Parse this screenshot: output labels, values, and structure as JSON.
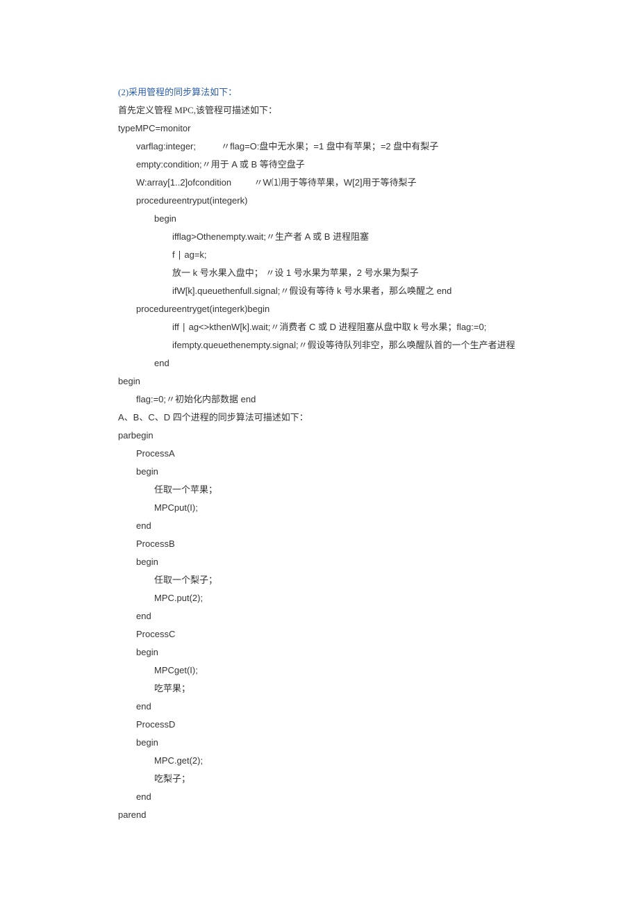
{
  "lines": [
    {
      "cls": "blue",
      "text": "(2)采用管程的同步算法如下："
    },
    {
      "cls": "",
      "text": "首先定义管程 MPC,该管程可描述如下："
    },
    {
      "cls": "mono",
      "text": "typeMPC=monitor"
    },
    {
      "cls": "mono i1",
      "text": "varflag:integer;          〃flag=O:盘中无水果；=1 盘中有苹果；=2 盘中有梨子"
    },
    {
      "cls": "mono i1",
      "text": "empty:condition;〃用于 A 或 B 等待空盘子"
    },
    {
      "cls": "mono i1",
      "text": "W:array[1..2]ofcondition         〃W⑴用于等待苹果，W[2]用于等待梨子"
    },
    {
      "cls": "mono i1",
      "text": "procedureentryput(integerk)"
    },
    {
      "cls": "mono i2",
      "text": "begin"
    },
    {
      "cls": "mono i3",
      "text": "ifflag>Othenempty.wait;〃生产者 A 或 B 进程阻塞"
    },
    {
      "cls": "mono i3",
      "text": "f ∣ ag=k;"
    },
    {
      "cls": "mono i3",
      "text": "放一 k 号水果入盘中； 〃设 1 号水果为苹果，2 号水果为梨子"
    },
    {
      "cls": "mono i3",
      "text": "ifW[k].queuethenfull.signal;〃假设有等待 k 号水果者，那么唤醒之 end"
    },
    {
      "cls": "mono i1",
      "text": "procedureentryget(integerk)begin"
    },
    {
      "cls": "mono i3",
      "text": "iff ∣ ag<>kthenW[k].wait;〃消费者 C 或 D 进程阻塞从盘中取 k 号水果；flag:=0;"
    },
    {
      "cls": "mono i3",
      "text": "ifempty.queuethenempty.signal;〃假设等待队列非空，那么唤醒队首的一个生产者进程"
    },
    {
      "cls": "mono i2",
      "text": "end"
    },
    {
      "cls": "mono",
      "text": "begin"
    },
    {
      "cls": "mono i1",
      "text": "flag:=0;〃初始化内部数据 end"
    },
    {
      "cls": "mono",
      "text": "A、B、C、D 四个进程的同步算法可描述如下："
    },
    {
      "cls": "mono",
      "text": "parbegin"
    },
    {
      "cls": "mono i1",
      "text": "ProcessA"
    },
    {
      "cls": "mono i1",
      "text": "begin"
    },
    {
      "cls": "mono i2",
      "text": "任取一个苹果；"
    },
    {
      "cls": "mono i2",
      "text": "MPCput(I);"
    },
    {
      "cls": "mono i1",
      "text": "end"
    },
    {
      "cls": "mono i1",
      "text": "ProcessB"
    },
    {
      "cls": "mono i1",
      "text": "begin"
    },
    {
      "cls": "mono i2",
      "text": "任取一个梨子；"
    },
    {
      "cls": "mono i2",
      "text": "MPC.put(2);"
    },
    {
      "cls": "mono i1",
      "text": "end"
    },
    {
      "cls": "mono i1",
      "text": "ProcessC"
    },
    {
      "cls": "mono i1",
      "text": "begin"
    },
    {
      "cls": "mono i2",
      "text": "MPCget(I);"
    },
    {
      "cls": "mono i2",
      "text": "吃苹果；"
    },
    {
      "cls": "mono i1",
      "text": "end"
    },
    {
      "cls": "mono i1",
      "text": "ProcessD"
    },
    {
      "cls": "mono i1",
      "text": "begin"
    },
    {
      "cls": "mono i2",
      "text": "MPC.get(2);"
    },
    {
      "cls": "mono i2",
      "text": "吃梨子；"
    },
    {
      "cls": "mono i1",
      "text": "end"
    },
    {
      "cls": "mono",
      "text": "parend"
    }
  ]
}
